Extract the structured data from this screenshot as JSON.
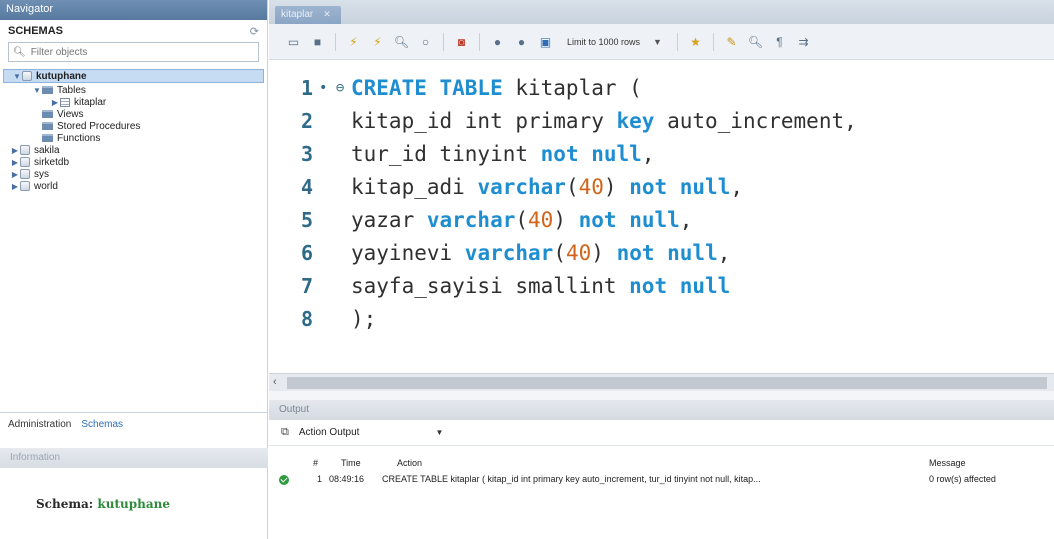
{
  "navigator": {
    "title": "Navigator",
    "schemas_label": "SCHEMAS",
    "filter_placeholder": "Filter objects",
    "tree": [
      {
        "label": "kutuphane"
      },
      {
        "label": "Tables"
      },
      {
        "label": "kitaplar"
      },
      {
        "label": "Views"
      },
      {
        "label": "Stored Procedures"
      },
      {
        "label": "Functions"
      },
      {
        "label": "sakila"
      },
      {
        "label": "sirketdb"
      },
      {
        "label": "sys"
      },
      {
        "label": "world"
      }
    ],
    "tabs": {
      "administration": "Administration",
      "schemas": "Schemas"
    },
    "information_title": "Information",
    "schema_info": {
      "label": "Schema:",
      "value": "kutuphane"
    }
  },
  "editor": {
    "tab_label": "kitaplar",
    "limit_label": "Limit to 1000 rows",
    "lines": [
      {
        "n": "1",
        "parts": [
          {
            "t": "CREATE TABLE",
            "c": "kw"
          },
          {
            "t": " kitaplar (",
            "c": "plain"
          }
        ]
      },
      {
        "n": "2",
        "parts": [
          {
            "t": "kitap_id int primary ",
            "c": "plain"
          },
          {
            "t": "key",
            "c": "kw"
          },
          {
            "t": " auto_increment,",
            "c": "plain"
          }
        ]
      },
      {
        "n": "3",
        "parts": [
          {
            "t": "tur_id tinyint ",
            "c": "plain"
          },
          {
            "t": "not null",
            "c": "kw"
          },
          {
            "t": ",",
            "c": "plain"
          }
        ]
      },
      {
        "n": "4",
        "parts": [
          {
            "t": "kitap_adi ",
            "c": "plain"
          },
          {
            "t": "varchar",
            "c": "kw"
          },
          {
            "t": "(",
            "c": "plain"
          },
          {
            "t": "40",
            "c": "num"
          },
          {
            "t": ") ",
            "c": "plain"
          },
          {
            "t": "not null",
            "c": "kw"
          },
          {
            "t": ",",
            "c": "plain"
          }
        ]
      },
      {
        "n": "5",
        "parts": [
          {
            "t": "yazar ",
            "c": "plain"
          },
          {
            "t": "varchar",
            "c": "kw"
          },
          {
            "t": "(",
            "c": "plain"
          },
          {
            "t": "40",
            "c": "num"
          },
          {
            "t": ") ",
            "c": "plain"
          },
          {
            "t": "not null",
            "c": "kw"
          },
          {
            "t": ",",
            "c": "plain"
          }
        ]
      },
      {
        "n": "6",
        "parts": [
          {
            "t": "yayinevi ",
            "c": "plain"
          },
          {
            "t": "varchar",
            "c": "kw"
          },
          {
            "t": "(",
            "c": "plain"
          },
          {
            "t": "40",
            "c": "num"
          },
          {
            "t": ") ",
            "c": "plain"
          },
          {
            "t": "not null",
            "c": "kw"
          },
          {
            "t": ",",
            "c": "plain"
          }
        ]
      },
      {
        "n": "7",
        "parts": [
          {
            "t": "sayfa_sayisi smallint ",
            "c": "plain"
          },
          {
            "t": "not null",
            "c": "kw"
          }
        ]
      },
      {
        "n": "8",
        "parts": [
          {
            "t": ");",
            "c": "plain"
          }
        ]
      }
    ]
  },
  "output": {
    "title": "Output",
    "selector_label": "Action Output",
    "columns": {
      "num": "#",
      "time": "Time",
      "action": "Action",
      "message": "Message"
    },
    "rows": [
      {
        "num": "1",
        "time": "08:49:16",
        "action": "CREATE TABLE kitaplar ( kitap_id int primary key auto_increment, tur_id tinyint not null, kitap...",
        "message": "0 row(s) affected"
      }
    ]
  },
  "colors": {
    "keyword": "#1e8ed0",
    "number": "#d2651c",
    "line_number": "#2f6b88",
    "success": "#2f9a3e",
    "schema_value": "#2f8a3a"
  }
}
